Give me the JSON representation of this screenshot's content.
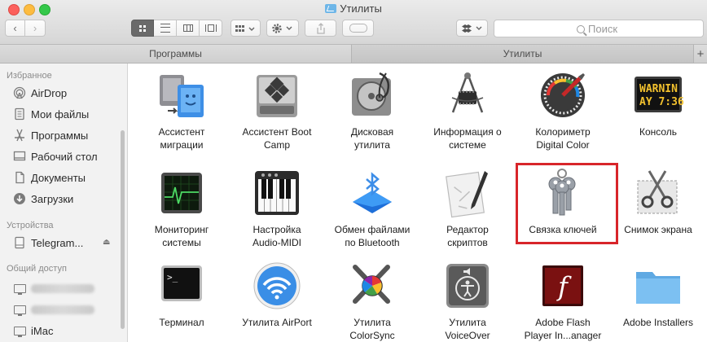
{
  "window": {
    "title": "Утилиты"
  },
  "toolbar": {
    "back": "‹",
    "forward": "›",
    "search_placeholder": "Поиск"
  },
  "tabs": [
    {
      "label": "Программы"
    },
    {
      "label": "Утилиты"
    }
  ],
  "tab_add": "+",
  "sidebar": {
    "favorites_title": "Избранное",
    "favorites": [
      {
        "label": "AirDrop",
        "icon": "airdrop-icon"
      },
      {
        "label": "Мои файлы",
        "icon": "all-files-icon"
      },
      {
        "label": "Программы",
        "icon": "applications-icon"
      },
      {
        "label": "Рабочий стол",
        "icon": "desktop-icon"
      },
      {
        "label": "Документы",
        "icon": "documents-icon"
      },
      {
        "label": "Загрузки",
        "icon": "downloads-icon"
      }
    ],
    "devices_title": "Устройства",
    "devices": [
      {
        "label": "Telegram...",
        "icon": "drive-icon"
      }
    ],
    "shared_title": "Общий доступ",
    "shared": [
      {
        "label": "",
        "icon": "monitor-icon"
      },
      {
        "label": "",
        "icon": "monitor-icon"
      },
      {
        "label": "iMac",
        "icon": "monitor-icon"
      }
    ]
  },
  "apps": [
    {
      "line1": "Ассистент",
      "line2": "миграции"
    },
    {
      "line1": "Ассистент Boot",
      "line2": "Camp"
    },
    {
      "line1": "Дисковая",
      "line2": "утилита"
    },
    {
      "line1": "Информация о",
      "line2": "системе"
    },
    {
      "line1": "Колориметр",
      "line2": "Digital Color"
    },
    {
      "line1": "Консоль",
      "line2": ""
    },
    {
      "line1": "Мониторинг",
      "line2": "системы"
    },
    {
      "line1": "Настройка",
      "line2": "Audio-MIDI"
    },
    {
      "line1": "Обмен файлами",
      "line2": "по Bluetooth"
    },
    {
      "line1": "Редактор",
      "line2": "скриптов"
    },
    {
      "line1": "Связка ключей",
      "line2": ""
    },
    {
      "line1": "Снимок экрана",
      "line2": ""
    },
    {
      "line1": "Терминал",
      "line2": ""
    },
    {
      "line1": "Утилита AirPort",
      "line2": ""
    },
    {
      "line1": "Утилита",
      "line2": "ColorSync"
    },
    {
      "line1": "Утилита",
      "line2": "VoiceOver"
    },
    {
      "line1": "Adobe Flash",
      "line2": "Player In...anager"
    },
    {
      "line1": "Adobe Installers",
      "line2": ""
    }
  ],
  "icon_texts": {
    "console_line1": "WARNIN",
    "console_line2": "AY 7:36",
    "terminal_prompt": ">_",
    "flash_letter": "f"
  },
  "colors": {
    "highlight": "#d8252a",
    "folder": "#6eb6e8"
  }
}
